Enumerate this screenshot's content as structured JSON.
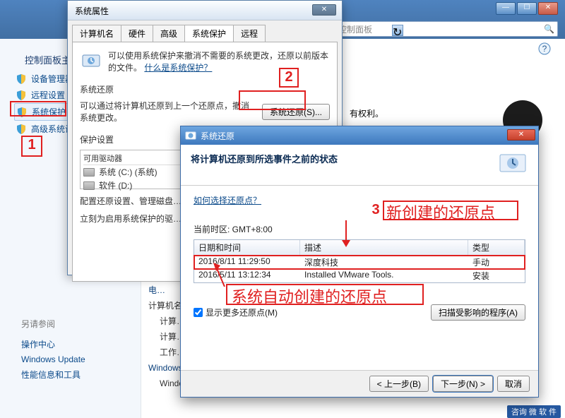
{
  "window": {
    "search_placeholder": "搜索控制面板"
  },
  "sidebar": {
    "title": "控制面板主页",
    "items": [
      {
        "label": "设备管理器"
      },
      {
        "label": "远程设置"
      },
      {
        "label": "系统保护"
      },
      {
        "label": "高级系统设置"
      }
    ]
  },
  "see_also": {
    "title": "另请参阅",
    "items": [
      "操作中心",
      "Windows Update",
      "性能信息和工具"
    ]
  },
  "main_bg": {
    "line0": "电…",
    "line1": "计算机名…",
    "line2": "计算…",
    "line3": "计算…",
    "line4": "工作…",
    "line5": "Windows…",
    "line6": "Windows 已激活",
    "note1": "有权利。"
  },
  "badge": "咨询 微 软 件",
  "annotations": {
    "a1": "1",
    "a2": "2",
    "a3": "3",
    "text3": "新创建的还原点",
    "text_auto": "系统自动创建的还原点"
  },
  "dlg1": {
    "title": "系统属性",
    "tabs": [
      "计算机名",
      "硬件",
      "高级",
      "系统保护",
      "远程"
    ],
    "intro": "可以使用系统保护来撤消不需要的系统更改，还原以前版本的文件。",
    "intro_link": "什么是系统保护？",
    "grp_restore": "系统还原",
    "restore_desc": "可以通过将计算机还原到上一个还原点，撤消系统更改。",
    "restore_btn": "系统还原(S)...",
    "grp_protect": "保护设置",
    "col_drive": "可用驱动器",
    "drive1": "系统 (C:) (系统)",
    "drive2": "软件 (D:)",
    "cfg_desc": "配置还原设置、管理磁盘…",
    "create_desc": "立刻为启用系统保护的驱…"
  },
  "dlg2": {
    "title": "系统还原",
    "heading": "将计算机还原到所选事件之前的状态",
    "how_link": "如何选择还原点？",
    "tz": "当前时区: GMT+8:00",
    "cols": [
      "日期和时间",
      "描述",
      "类型"
    ],
    "rows": [
      {
        "dt": "2016/8/11 11:29:50",
        "desc": "深度科技",
        "type": "手动"
      },
      {
        "dt": "2016/5/11 13:12:34",
        "desc": "Installed VMware Tools.",
        "type": "安装"
      }
    ],
    "show_more": "显示更多还原点(M)",
    "scan": "扫描受影响的程序(A)",
    "back": "< 上一步(B)",
    "next": "下一步(N) >",
    "cancel": "取消"
  }
}
